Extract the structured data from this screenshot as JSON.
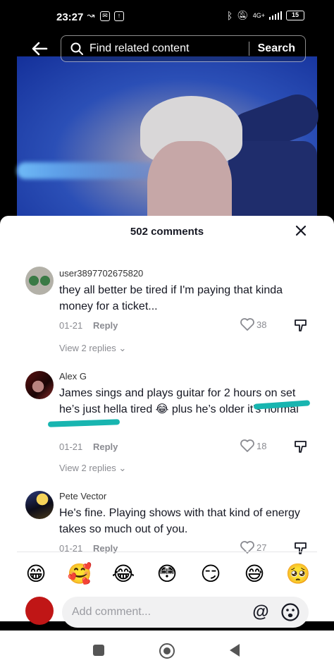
{
  "status_bar": {
    "time": "23:27",
    "network": "4G+",
    "battery": "15"
  },
  "search": {
    "placeholder": "Find related content",
    "button_label": "Search"
  },
  "comments_header": {
    "title": "502 comments"
  },
  "comments": [
    {
      "username": "user3897702675820",
      "text": "they all better be tired if I'm paying that kinda money for a ticket...",
      "date": "01-21",
      "reply_label": "Reply",
      "likes": "38",
      "view_replies": "View 2 replies"
    },
    {
      "username": "Alex G",
      "text": "James sings and plays guitar for 2 hours on set he’s just hella tired 😂 plus he’s older it’s normal",
      "date": "01-21",
      "reply_label": "Reply",
      "likes": "18",
      "view_replies": "View 2 replies"
    },
    {
      "username": "Pete Vector",
      "text": "He's fine. Playing shows with that kind of energy takes so much out of you.",
      "date": "01-21",
      "reply_label": "Reply",
      "likes": "27"
    }
  ],
  "emoji_bar": [
    "😁",
    "🥰",
    "😂",
    "😳",
    "😏",
    "😅",
    "🥺"
  ],
  "composer": {
    "placeholder": "Add comment...",
    "mention_symbol": "@"
  },
  "colors": {
    "highlight": "#18b5b0",
    "text": "#161823",
    "muted": "#8a8b91"
  }
}
